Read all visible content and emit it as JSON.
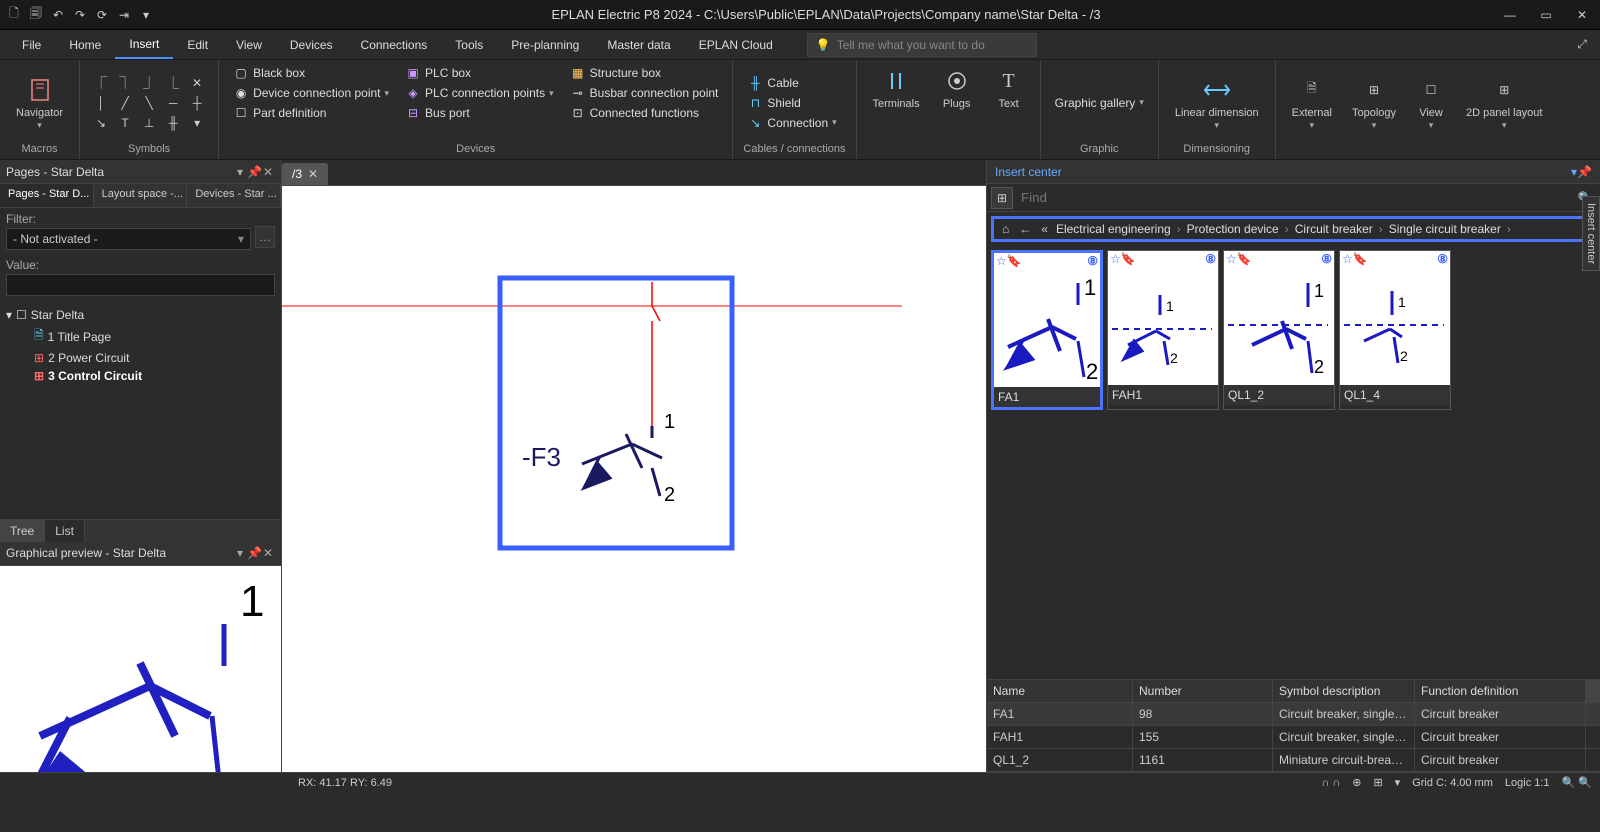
{
  "title": "EPLAN Electric P8 2024 - C:\\Users\\Public\\EPLAN\\Data\\Projects\\Company name\\Star Delta - /3",
  "menus": [
    "File",
    "Home",
    "Insert",
    "Edit",
    "View",
    "Devices",
    "Connections",
    "Tools",
    "Pre-planning",
    "Master data",
    "EPLAN Cloud"
  ],
  "active_menu": "Insert",
  "tellme_placeholder": "Tell me what you want to do",
  "ribbon": {
    "macros_label": "Macros",
    "navigator": "Navigator",
    "symbols_label": "Symbols",
    "devices_label": "Devices",
    "blackbox": "Black box",
    "devconn": "Device connection point",
    "partdef": "Part definition",
    "plcbox": "PLC box",
    "plcconn": "PLC connection points",
    "busport": "Bus port",
    "structbox": "Structure box",
    "busbar": "Busbar connection point",
    "connfunc": "Connected functions",
    "cables_label": "Cables / connections",
    "cable": "Cable",
    "shield": "Shield",
    "connection": "Connection",
    "terminals": "Terminals",
    "plugs": "Plugs",
    "text": "Text",
    "graphic_gallery": "Graphic gallery",
    "graphic_label": "Graphic",
    "lindim": "Linear dimension",
    "dimensioning_label": "Dimensioning",
    "external": "External",
    "topology": "Topology",
    "view": "View",
    "panel2d": "2D panel layout"
  },
  "pages_panel": {
    "title": "Pages - Star Delta",
    "tabs": [
      "Pages - Star D...",
      "Layout space -...",
      "Devices - Star ..."
    ],
    "filter_label": "Filter:",
    "filter_value": "- Not activated -",
    "value_label": "Value:",
    "root": "Star Delta",
    "items": [
      {
        "label": "1 Title Page",
        "bold": false
      },
      {
        "label": "2 Power Circuit",
        "bold": false
      },
      {
        "label": "3 Control Circuit",
        "bold": true
      }
    ],
    "tree_tab": "Tree",
    "list_tab": "List"
  },
  "preview_panel": {
    "title": "Graphical preview - Star Delta"
  },
  "doc_tab": "/3",
  "canvas_symbol": {
    "tag": "-F3",
    "t1": "1",
    "t2": "2"
  },
  "insert_center": {
    "title": "Insert center",
    "find_placeholder": "Find",
    "side_tab": "Insert center",
    "breadcrumb": [
      "Electrical engineering",
      "Protection device",
      "Circuit breaker",
      "Single circuit breaker"
    ],
    "cards": [
      {
        "name": "FA1",
        "sel": true
      },
      {
        "name": "FAH1",
        "sel": false
      },
      {
        "name": "QL1_2",
        "sel": false
      },
      {
        "name": "QL1_4",
        "sel": false
      }
    ],
    "table": {
      "headers": [
        "Name",
        "Number",
        "Symbol description",
        "Function definition"
      ],
      "rows": [
        {
          "name": "FA1",
          "num": "98",
          "desc": "Circuit breaker, single-p...",
          "func": "Circuit breaker",
          "sel": true
        },
        {
          "name": "FAH1",
          "num": "155",
          "desc": "Circuit breaker, single-p...",
          "func": "Circuit breaker",
          "sel": false
        },
        {
          "name": "QL1_2",
          "num": "1161",
          "desc": "Miniature circuit-breake...",
          "func": "Circuit breaker",
          "sel": false
        }
      ]
    }
  },
  "status": {
    "coords": "RX: 41.17 RY: 6.49",
    "grid": "Grid C: 4.00 mm",
    "logic": "Logic 1:1"
  }
}
